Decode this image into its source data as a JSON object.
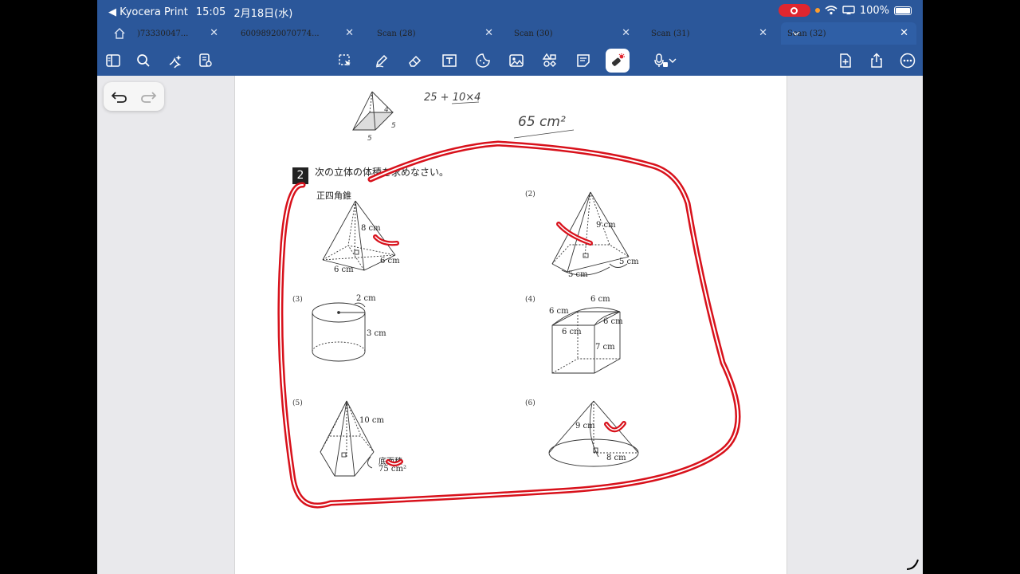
{
  "status": {
    "back_app": "◀ Kyocera Print",
    "time": "15:05",
    "date": "2月18日(水)",
    "battery": "100%"
  },
  "tabs": [
    {
      "label": ")73330047..."
    },
    {
      "label": "60098920070774..."
    },
    {
      "label": "Scan (28)"
    },
    {
      "label": "Scan (30)"
    },
    {
      "label": "Scan (31)"
    },
    {
      "label": "Scan (32)"
    }
  ],
  "page": {
    "handwriting": {
      "calc": "25 + 10×4",
      "answer": "65 cm²",
      "dim_4": "4",
      "dim_5a": "5",
      "dim_5b": "5"
    },
    "question": {
      "number": "2",
      "instruction": "次の立体の体積を求めなさい。",
      "q1_title": "正四角錐",
      "q1_labels": [
        "8 cm",
        "6 cm",
        "6 cm"
      ],
      "q2_num": "(2)",
      "q2_labels": [
        "9 cm",
        "5 cm",
        "5 cm"
      ],
      "q3_num": "(3)",
      "q3_labels": [
        "2 cm",
        "3 cm"
      ],
      "q4_num": "(4)",
      "q4_labels": [
        "6 cm",
        "6 cm",
        "6 cm",
        "6 cm",
        "7 cm"
      ],
      "q5_num": "(5)",
      "q5_labels": [
        "10 cm",
        "底面積",
        "75 cm²"
      ],
      "q6_num": "(6)",
      "q6_labels": [
        "9 cm",
        "8 cm"
      ]
    }
  },
  "colors": {
    "chrome_blue": "#2b579a",
    "ink_red": "#d8111b",
    "record_red": "#e0262f"
  }
}
